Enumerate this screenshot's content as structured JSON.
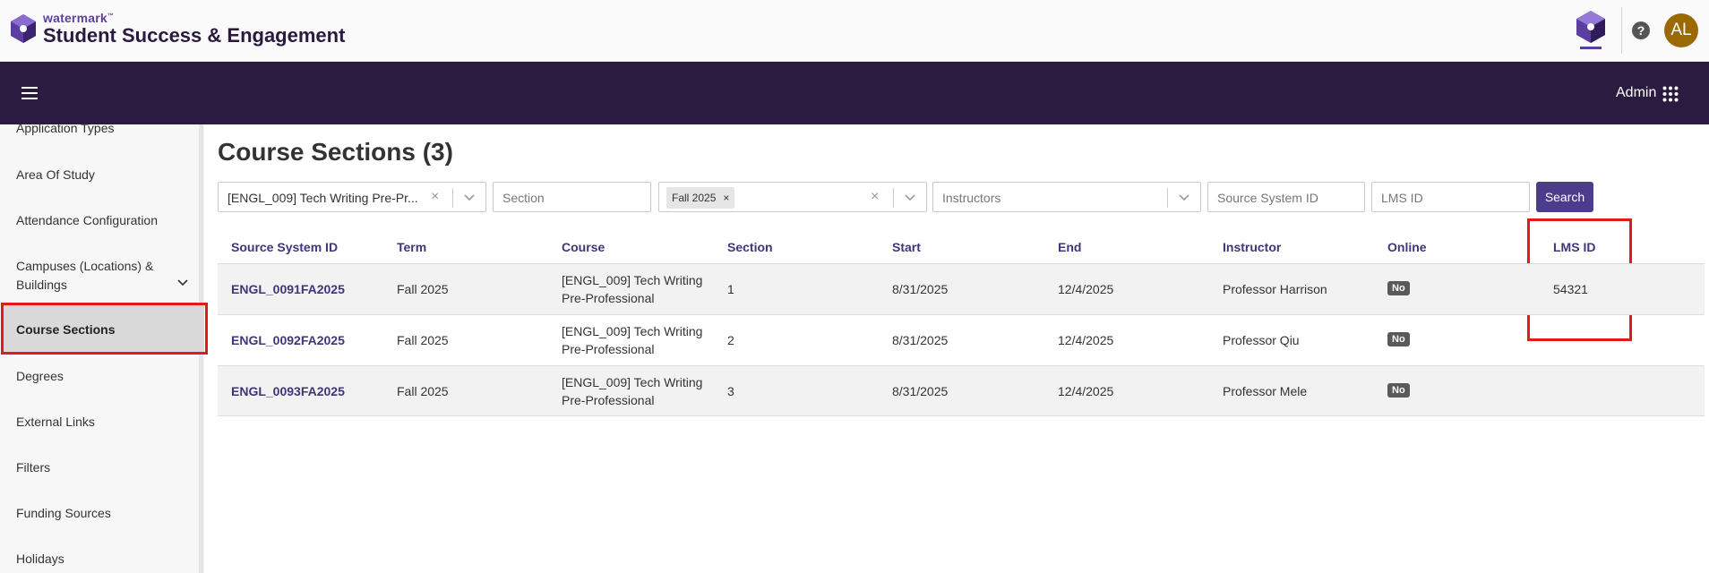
{
  "header": {
    "brand_small": "watermark",
    "brand_tm": "™",
    "brand_title": "Student Success & Engagement",
    "help_label": "?",
    "avatar_initials": "AL"
  },
  "navbar": {
    "admin_label": "Admin"
  },
  "sidebar": {
    "items": [
      {
        "label": "Application Types"
      },
      {
        "label": "Area Of Study"
      },
      {
        "label": "Attendance Configuration"
      },
      {
        "label": "Campuses (Locations) &"
      },
      {
        "label": "Buildings"
      },
      {
        "label": "Course Sections"
      },
      {
        "label": "Degrees"
      },
      {
        "label": "External Links"
      },
      {
        "label": "Filters"
      },
      {
        "label": "Funding Sources"
      },
      {
        "label": "Holidays"
      }
    ]
  },
  "main": {
    "title": "Course Sections (3)",
    "filters": {
      "course_value": "[ENGL_009] Tech Writing Pre-Pr...",
      "section_placeholder": "Section",
      "term_chip": "Fall 2025",
      "chip_remove": "×",
      "instructors_placeholder": "Instructors",
      "source_id_placeholder": "Source System ID",
      "lms_id_placeholder": "LMS ID",
      "clear_glyph": "×",
      "search_label": "Search"
    },
    "table": {
      "columns": [
        "Source System ID",
        "Term",
        "Course",
        "Section",
        "Start",
        "End",
        "Instructor",
        "Online",
        "LMS ID"
      ],
      "rows": [
        {
          "source_id": "ENGL_0091FA2025",
          "term": "Fall 2025",
          "course_line1": "[ENGL_009] Tech Writing",
          "course_line2": "Pre-Professional",
          "section": "1",
          "start": "8/31/2025",
          "end": "12/4/2025",
          "instructor": "Professor Harrison",
          "online": "No",
          "lms_id": "54321"
        },
        {
          "source_id": "ENGL_0092FA2025",
          "term": "Fall 2025",
          "course_line1": "[ENGL_009] Tech Writing",
          "course_line2": "Pre-Professional",
          "section": "2",
          "start": "8/31/2025",
          "end": "12/4/2025",
          "instructor": "Professor Qiu",
          "online": "No",
          "lms_id": ""
        },
        {
          "source_id": "ENGL_0093FA2025",
          "term": "Fall 2025",
          "course_line1": "[ENGL_009] Tech Writing",
          "course_line2": "Pre-Professional",
          "section": "3",
          "start": "8/31/2025",
          "end": "12/4/2025",
          "instructor": "Professor Mele",
          "online": "No",
          "lms_id": ""
        }
      ]
    }
  },
  "colors": {
    "brand_purple": "#2b1b40",
    "link_purple": "#40357a",
    "button_purple": "#4b3c8c",
    "avatar": "#9a6a00",
    "highlight_red": "#e01b1b"
  },
  "icons": [
    "watermark-logo-icon",
    "help-icon",
    "hamburger-icon",
    "apps-grid-icon",
    "chevron-down-icon",
    "clear-icon"
  ]
}
